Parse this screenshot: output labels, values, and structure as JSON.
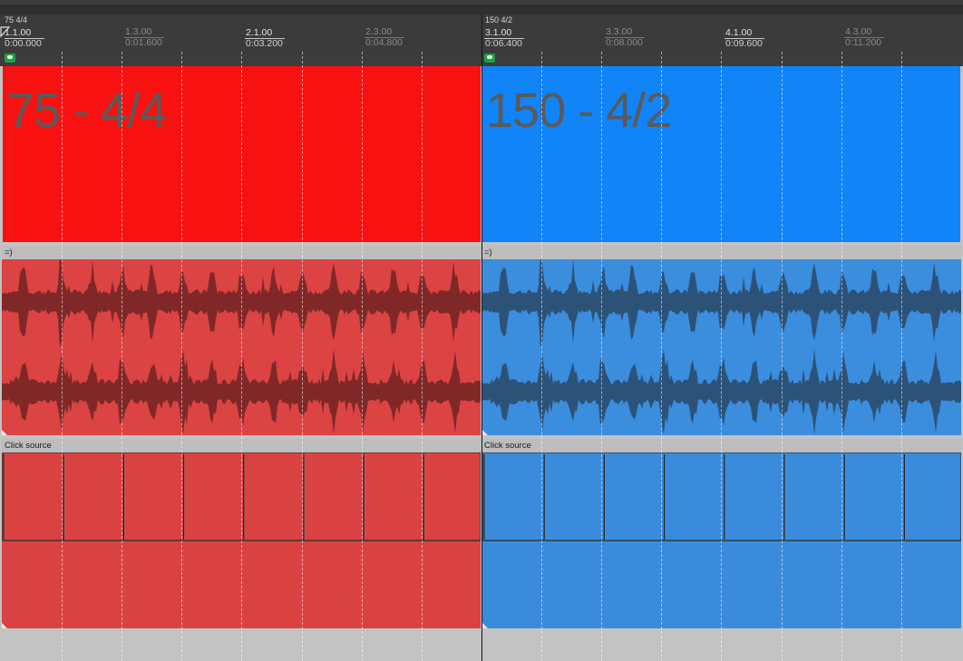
{
  "tempo_markers": [
    {
      "label": "75 4/4"
    },
    {
      "label": "150 4/2"
    }
  ],
  "ruler": [
    {
      "beat": "1.1.00",
      "time": "0:00.000",
      "major": true
    },
    {
      "beat": "1.3.00",
      "time": "0:01.600",
      "major": false
    },
    {
      "beat": "2.1.00",
      "time": "0:03.200",
      "major": true
    },
    {
      "beat": "2.3.00",
      "time": "0:04.800",
      "major": false
    },
    {
      "beat": "3.1.00",
      "time": "0:06.400",
      "major": true
    },
    {
      "beat": "3.3.00",
      "time": "0:08.000",
      "major": false
    },
    {
      "beat": "4.1.00",
      "time": "0:09.600",
      "major": true
    },
    {
      "beat": "4.3.00",
      "time": "0:11.200",
      "major": false
    }
  ],
  "regions": [
    {
      "title": "75 - 4/4",
      "color": "#f81111"
    },
    {
      "title": "150 - 4/2",
      "color": "#1184f7"
    }
  ],
  "audio_items": [
    {
      "label": "=)",
      "color": "#dc4343",
      "wave_color": "#7a2727"
    },
    {
      "label": "=)",
      "color": "#3b8ddd",
      "wave_color": "#2b4f72"
    }
  ],
  "click_items": [
    {
      "label": "Click source",
      "color": "#da4242"
    },
    {
      "label": "Click source",
      "color": "#3a8bdc"
    }
  ],
  "colors": {
    "marker_icon": "#1ea040",
    "ruler_bg": "#3b3b3b",
    "track_bg": "#c3c3c3"
  }
}
